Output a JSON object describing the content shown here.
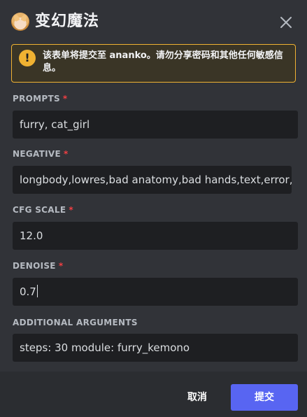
{
  "modal": {
    "title": "变幻魔法",
    "close_icon": "close-icon",
    "avatar_icon": "app-avatar"
  },
  "notice": {
    "icon": "warning-icon",
    "icon_glyph": "!",
    "text": "该表单将提交至 ananko。请勿分享密码和其他任何敏感信息。",
    "color": "#f0b232"
  },
  "fields": [
    {
      "label": "PROMPTS",
      "required": true,
      "value": "furry, cat_girl"
    },
    {
      "label": "NEGATIVE",
      "required": true,
      "value": "longbody,lowres,bad anatomy,bad hands,text,error,missing"
    },
    {
      "label": "CFG SCALE",
      "required": true,
      "value": "12.0"
    },
    {
      "label": "DENOISE",
      "required": true,
      "value": "0.7"
    },
    {
      "label": "ADDITIONAL ARGUMENTS",
      "required": false,
      "value": "steps: 30 module: furry_kemono"
    }
  ],
  "footer": {
    "cancel_label": "取消",
    "submit_label": "提交",
    "accent": "#5865f2"
  },
  "required_marker": "*"
}
